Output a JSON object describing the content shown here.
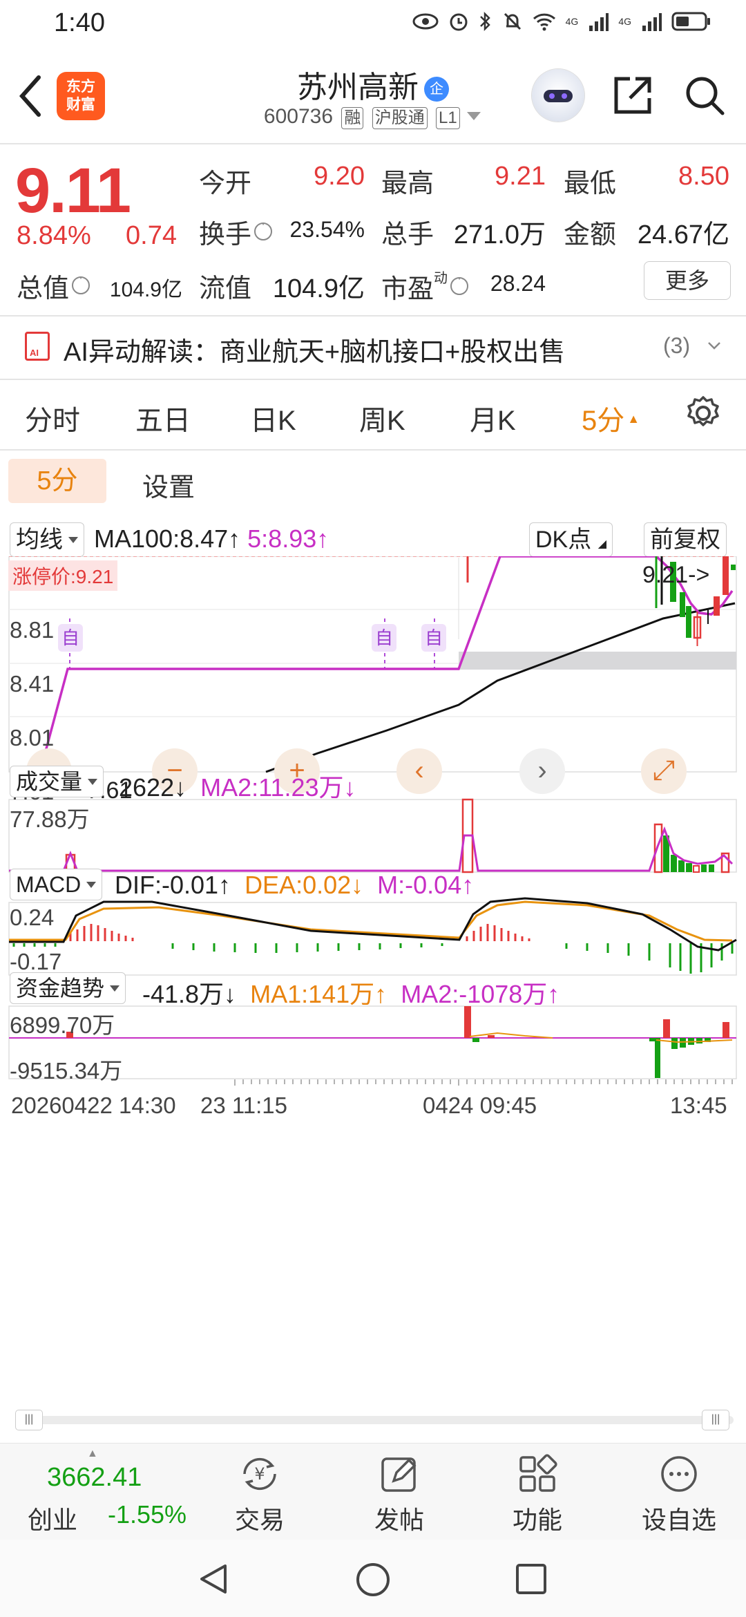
{
  "status_bar": {
    "time": "1:40",
    "net1": "4G",
    "net2": "4G"
  },
  "header": {
    "logo_line1": "东方",
    "logo_line2": "财富",
    "title": "苏州高新",
    "title_badge": "企",
    "code": "600736",
    "tag1": "融",
    "tag2": "沪股通",
    "tag3": "L1"
  },
  "quote": {
    "price": "9.11",
    "change_pct": "8.84%",
    "change": "0.74",
    "open_label": "今开",
    "open": "9.20",
    "high_label": "最高",
    "high": "9.21",
    "low_label": "最低",
    "low": "8.50",
    "turnover_label": "换手",
    "turnover": "23.54%",
    "volume_label": "总手",
    "volume": "271.0万",
    "amount_label": "金额",
    "amount": "24.67亿",
    "mktcap_label": "总值",
    "mktcap": "104.9亿",
    "float_label": "流值",
    "float": "104.9亿",
    "pe_label": "市盈",
    "pe_sup": "动",
    "pe": "28.24",
    "more": "更多"
  },
  "ai_bar": {
    "icon_text": "AI",
    "text": "AI异动解读：商业航天+脑机接口+股权出售",
    "count": "(3)"
  },
  "tabs": [
    "分时",
    "五日",
    "日K",
    "周K",
    "月K",
    "5分"
  ],
  "active_tab": "5分",
  "sub_tabs": {
    "active": "5分",
    "settings": "设置"
  },
  "main_chart": {
    "ma_selector": "均线",
    "ma100": "MA100:8.47↑",
    "ma5": "5:8.93↑",
    "dk_button": "DK点",
    "fq_button": "前复权",
    "limit_label": "涨停价:9.21",
    "y_labels": [
      "8.81",
      "8.41",
      "8.01",
      "7.61"
    ],
    "high_marker": "9.21->",
    "low_marker": "<-7.61",
    "self_marks": [
      "自",
      "自",
      "自"
    ]
  },
  "volume_chart": {
    "selector": "成交量",
    "value": "2622↓",
    "ma2": "MA2:11.23万↓",
    "y_top": "77.88万"
  },
  "macd_chart": {
    "selector": "MACD",
    "dif": "DIF:-0.01↑",
    "dea": "DEA:0.02↓",
    "m": "M:-0.04↑",
    "y_top": "0.24",
    "y_bottom": "-0.17"
  },
  "fund_chart": {
    "selector": "资金趋势",
    "value": "-41.8万↓",
    "ma1": "MA1:141万↑",
    "ma2": "MA2:-1078万↑",
    "y_top": "6899.70万",
    "y_bottom": "-9515.34万"
  },
  "x_axis": {
    "left": "20260422 14:30",
    "mid1": "23 11:15",
    "mid2": "0424 09:45",
    "right": "13:45"
  },
  "bottom_bar": {
    "index_value": "3662.41",
    "index_name": "创业",
    "index_pct": "-1.55%",
    "buttons": [
      "交易",
      "发帖",
      "功能",
      "设自选"
    ]
  },
  "colors": {
    "up": "#e33939",
    "down": "#14a014",
    "accent": "#e8830f",
    "ma5": "#c72fc4"
  }
}
